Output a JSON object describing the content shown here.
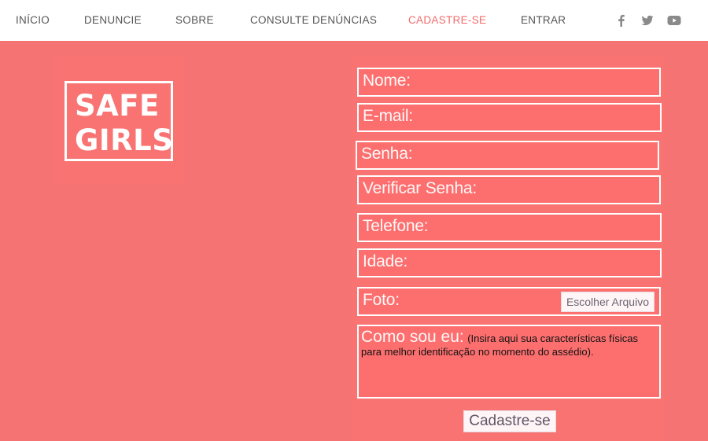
{
  "nav": {
    "items": [
      "INÍCIO",
      "DENUNCIE",
      "SOBRE",
      "CONSULTE DENÚNCIAS",
      "CADASTRE-SE",
      "ENTRAR"
    ],
    "active": "CADASTRE-SE",
    "active_color": "#f16b6b",
    "social_icons": [
      "facebook-icon",
      "twitter-icon",
      "youtube-icon"
    ]
  },
  "logo": {
    "line1": "SAFE",
    "line2": "GIRLS"
  },
  "form": {
    "nome_label": "Nome:",
    "email_label": "E-mail:",
    "senha_label": "Senha:",
    "verificar_label": "Verificar Senha:",
    "telefone_label": "Telefone:",
    "idade_label": "Idade:",
    "foto_label": "Foto:",
    "file_button": "Escolher Arquivo",
    "como_label": "Como sou eu:",
    "como_hint": "(Insira aqui sua características físicas para melhor identificação no momento do assédio).",
    "submit": "Cadastre-se"
  },
  "colors": {
    "background": "#f67373",
    "field_fill": "#fd6f6f",
    "border": "#ffffff"
  }
}
